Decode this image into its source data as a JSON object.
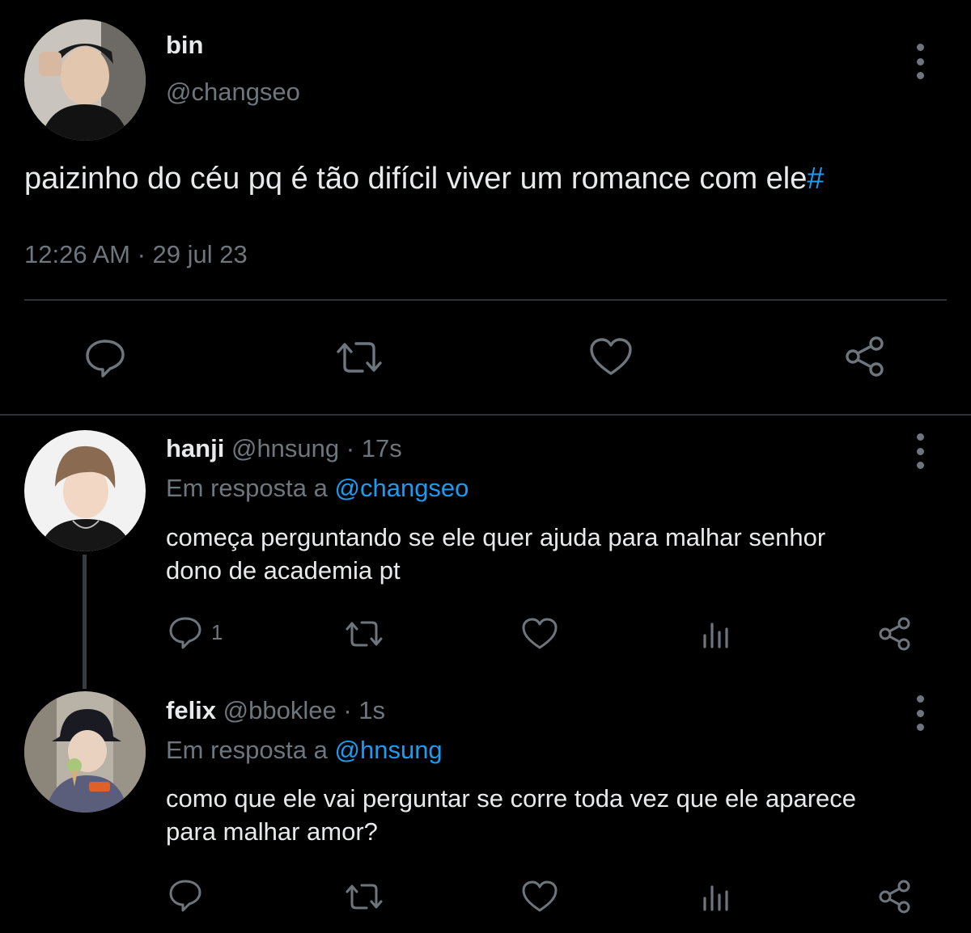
{
  "main_tweet": {
    "name": "bin",
    "handle": "@changseo",
    "text": "paizinho do céu pq é tão difícil viver um romance com ele",
    "hashtag": "#",
    "timestamp": "12:26 AM · 29 jul 23",
    "actions": [
      "comment-icon",
      "retweet-icon",
      "like-icon",
      "share-icon"
    ]
  },
  "replies": [
    {
      "name": "hanji",
      "handle": "@hnsung",
      "time": "· 17s",
      "reply_prefix": "Em resposta a",
      "reply_to": "@changseo",
      "text_line1": "começa perguntando se ele quer ajuda para malhar senhor",
      "text_line2": "dono de academia pt",
      "reply_count": "1"
    },
    {
      "name": "felix",
      "handle": "@bboklee",
      "time": "· 1s",
      "reply_prefix": "Em resposta a",
      "reply_to": "@hnsung",
      "text_line1": "como que ele vai perguntar se corre toda vez que ele aparece",
      "text_line2": "para malhar amor?",
      "reply_count": ""
    }
  ],
  "colors": {
    "background": "#000000",
    "text": "#e7e9ea",
    "muted": "#6e767d",
    "accent": "#1d9bf0",
    "divider": "#2f3336"
  }
}
